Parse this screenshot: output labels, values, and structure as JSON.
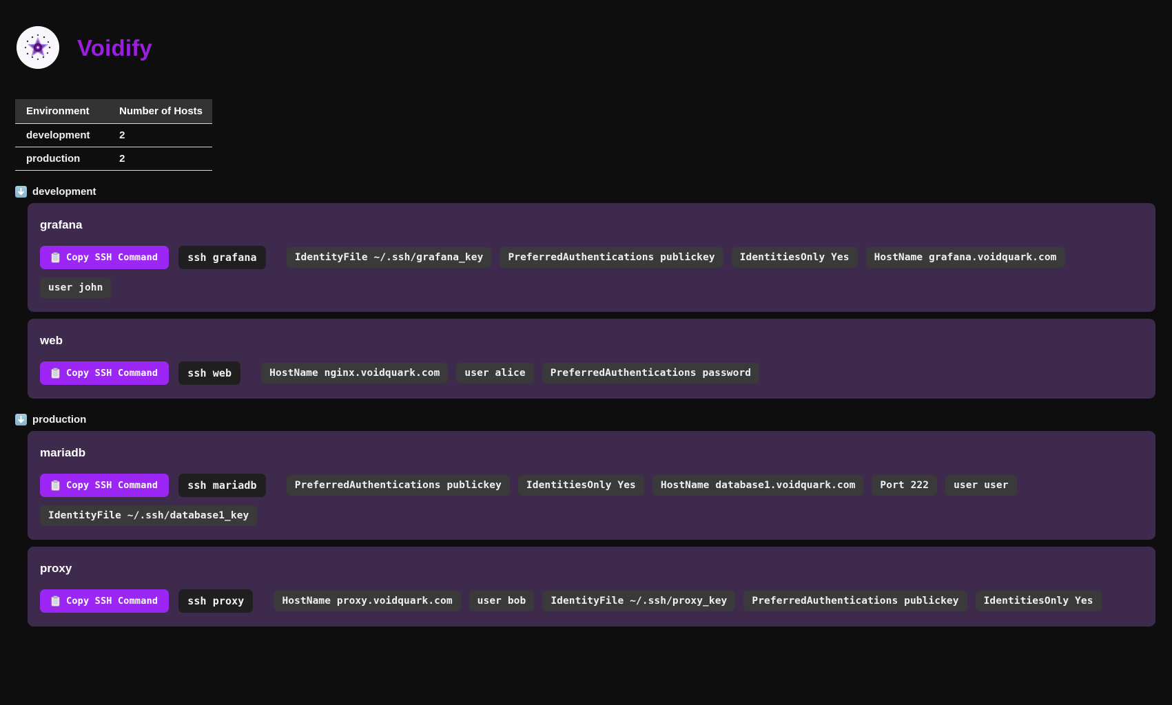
{
  "app": {
    "title": "Voidify",
    "logo_icon": "voidify-atom-logo",
    "accent_color": "#9b1fe0",
    "button_color": "#9c27f5",
    "card_color": "#3e2a4d",
    "background_color": "#0e0e0e"
  },
  "summary_table": {
    "columns": [
      "Environment",
      "Number of Hosts"
    ],
    "rows": [
      {
        "environment": "development",
        "hosts": "2"
      },
      {
        "environment": "production",
        "hosts": "2"
      }
    ]
  },
  "copy_button_label": "Copy SSH Command",
  "copy_button_icon": "clipboard-icon",
  "group_icon": "down-arrow-icon",
  "environments": [
    {
      "name": "development",
      "hosts": [
        {
          "name": "grafana",
          "command": "ssh grafana",
          "options": [
            "IdentityFile ~/.ssh/grafana_key",
            "PreferredAuthentications publickey",
            "IdentitiesOnly Yes",
            "HostName grafana.voidquark.com",
            "user john"
          ]
        },
        {
          "name": "web",
          "command": "ssh web",
          "options": [
            "HostName nginx.voidquark.com",
            "user alice",
            "PreferredAuthentications password"
          ]
        }
      ]
    },
    {
      "name": "production",
      "hosts": [
        {
          "name": "mariadb",
          "command": "ssh mariadb",
          "options": [
            "PreferredAuthentications publickey",
            "IdentitiesOnly Yes",
            "HostName database1.voidquark.com",
            "Port 222",
            "user user",
            "IdentityFile ~/.ssh/database1_key"
          ]
        },
        {
          "name": "proxy",
          "command": "ssh proxy",
          "options": [
            "HostName proxy.voidquark.com",
            "user bob",
            "IdentityFile ~/.ssh/proxy_key",
            "PreferredAuthentications publickey",
            "IdentitiesOnly Yes"
          ]
        }
      ]
    }
  ]
}
